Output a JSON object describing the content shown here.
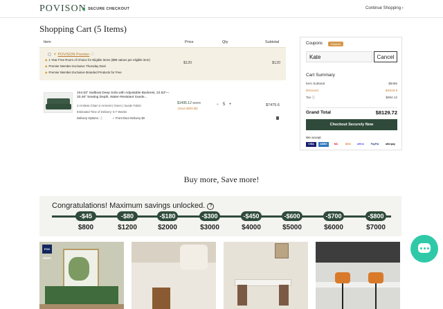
{
  "header": {
    "logo": "POVISON",
    "secure_label": "SECURE CHECKOUT",
    "continue_label": "Continue Shopping",
    "continue_icon": "chevron-right-icon"
  },
  "cart": {
    "title": "Shopping Cart (5 Items)",
    "columns": {
      "item": "Item",
      "price": "Price",
      "qty": "Qty",
      "subtotal": "Subtotal"
    },
    "premier": {
      "title": "POVISON Premier",
      "perks": [
        "1 Year Free Room of Choice for Eligible Items ($99 values per eligible item)",
        "Premier Member Exclusive Thursday Deal",
        "Premier Member Exclusive Branded Products for Free"
      ],
      "price": "$120",
      "subtotal": "$120"
    },
    "item": {
      "name": "104.53\" Sailboat Deep Sofa with Adjustable Backrest, 22.83\"—33.46\" Seating Depth, Water-Resistant Suede...",
      "options": "3 Armless Chair+2 Armrest  |  Green  |  Suede Fabric",
      "eta": "Estimated Time of Delivery: 5-7 Weeks",
      "delivery_label": "Delivery Options:",
      "delivery_choice": "Front Door Delivery  $0",
      "price": "$1495.12",
      "original_price": "$1899",
      "save": "(Save $303.88)",
      "qty_minus": "−",
      "qty": "5",
      "qty_plus": "+",
      "subtotal": "$7475.6"
    }
  },
  "summary": {
    "coupons_label": "Coupons",
    "coupons_badge": "Coupon",
    "coupon_value": "Kate",
    "cancel_label": "Cancel",
    "title": "Cart Summary",
    "item_subtotal_label": "Item Subtotal",
    "item_subtotal_value": "$8495",
    "discount_label": "Discount",
    "discount_value": "-$1519.8",
    "tax_label": "Tax",
    "tax_value": "$654.12",
    "grand_total_label": "Grand Total",
    "grand_total_value": "$8129.72",
    "checkout_label": "Checkout Securely Now",
    "accept_label": "We accept",
    "payments": [
      "VISA",
      "AMEX",
      "MC",
      "DISC",
      "affirm",
      "PayPal",
      "afterpay"
    ]
  },
  "promo": {
    "heading": "Buy more, Save more!",
    "congrats": "Congratulations! Maximum savings unlocked.",
    "help_glyph": "?",
    "tiers": [
      {
        "discount": "-$45",
        "threshold": "$800"
      },
      {
        "discount": "-$80",
        "threshold": "$1200"
      },
      {
        "discount": "-$180",
        "threshold": "$2000"
      },
      {
        "discount": "-$300",
        "threshold": "$3000"
      },
      {
        "discount": "-$450",
        "threshold": "$4000"
      },
      {
        "discount": "-$600",
        "threshold": "$5000"
      },
      {
        "discount": "-$700",
        "threshold": "$6000"
      },
      {
        "discount": "-$800",
        "threshold": "$7000"
      }
    ]
  },
  "products": {
    "fox_badge": "FOX NEWS"
  },
  "colors": {
    "brand_green": "#2f4a3a",
    "accent_orange": "#c77b2e",
    "chat": "#2fc9a8"
  },
  "icons": {
    "chat": "chat-bubble-icon"
  }
}
